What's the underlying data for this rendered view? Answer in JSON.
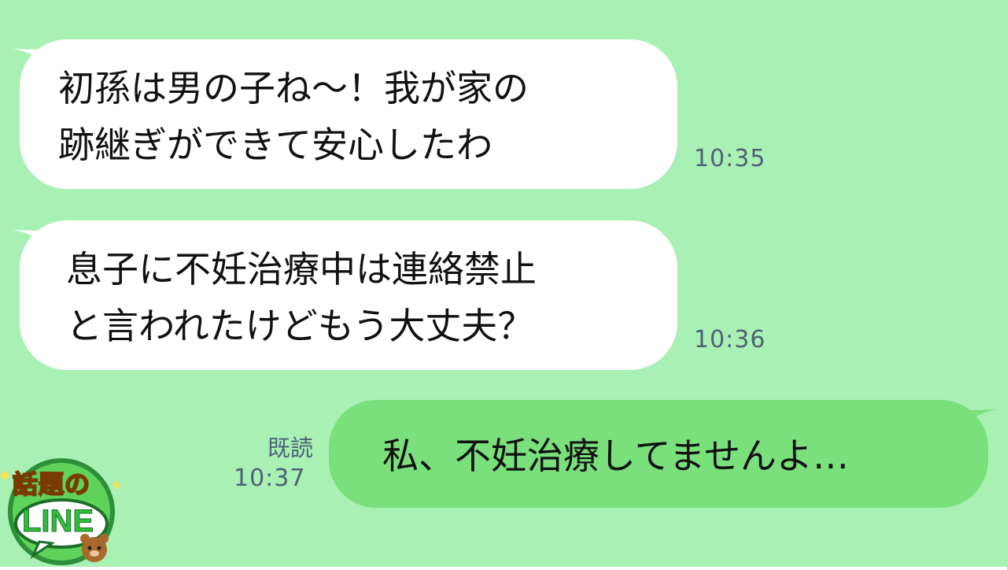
{
  "chat": {
    "messages": [
      {
        "direction": "incoming",
        "lines": [
          "初孫は男の子ね〜！我が家の",
          "跡継ぎができて安心したわ"
        ],
        "time": "10:35"
      },
      {
        "direction": "incoming",
        "lines": [
          "息子に不妊治療中は連絡禁止",
          "と言われたけどもう大丈夫？"
        ],
        "time": "10:36"
      },
      {
        "direction": "outgoing",
        "lines": [
          "私、不妊治療してませんよ…"
        ],
        "read_label": "既読",
        "time": "10:37"
      }
    ]
  },
  "logo": {
    "text_top": "話題の",
    "text_main": "LINE"
  },
  "colors": {
    "background": "#a9f0b5",
    "incoming_bubble": "#ffffff",
    "outgoing_bubble": "#79e07c",
    "timestamp": "#4d6277"
  }
}
